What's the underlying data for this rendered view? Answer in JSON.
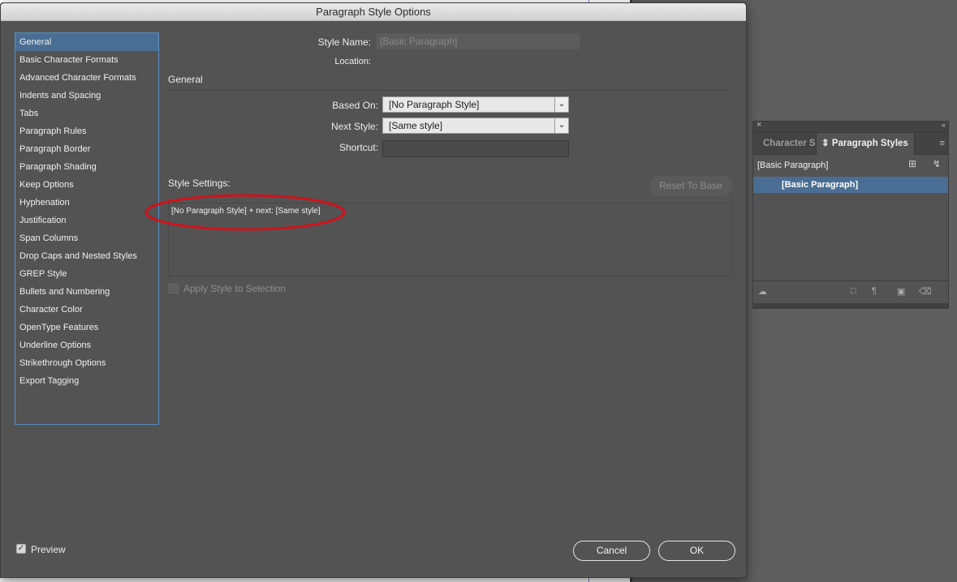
{
  "dialog": {
    "title": "Paragraph Style Options",
    "categories": [
      {
        "label": "General",
        "selected": true
      },
      {
        "label": "Basic Character Formats"
      },
      {
        "label": "Advanced Character Formats"
      },
      {
        "label": "Indents and Spacing"
      },
      {
        "label": "Tabs"
      },
      {
        "label": "Paragraph Rules"
      },
      {
        "label": "Paragraph Border"
      },
      {
        "label": "Paragraph Shading"
      },
      {
        "label": "Keep Options"
      },
      {
        "label": "Hyphenation"
      },
      {
        "label": "Justification"
      },
      {
        "label": "Span Columns"
      },
      {
        "label": "Drop Caps and Nested Styles"
      },
      {
        "label": "GREP Style"
      },
      {
        "label": "Bullets and Numbering"
      },
      {
        "label": "Character Color"
      },
      {
        "label": "OpenType Features"
      },
      {
        "label": "Underline Options"
      },
      {
        "label": "Strikethrough Options"
      },
      {
        "label": "Export Tagging"
      }
    ],
    "style_name_label": "Style Name:",
    "style_name_value": "[Basic Paragraph]",
    "location_label": "Location:",
    "general_heading": "General",
    "based_on_label": "Based On:",
    "based_on_value": "[No Paragraph Style]",
    "next_style_label": "Next Style:",
    "next_style_value": "[Same style]",
    "shortcut_label": "Shortcut:",
    "shortcut_value": "",
    "style_settings_label": "Style Settings:",
    "reset_button": "Reset To Base",
    "style_settings_text": "[No Paragraph Style] + next: [Same style]",
    "apply_label": "Apply Style to Selection",
    "apply_checked": false,
    "preview_label": "Preview",
    "preview_checked": true,
    "cancel_button": "Cancel",
    "ok_button": "OK",
    "highlight_color": "#d0121b",
    "selection_color": "#4a6e93"
  },
  "panel": {
    "tab_character": "Character S",
    "tab_paragraph": "Paragraph Styles",
    "current_style": "[Basic Paragraph]",
    "selected_style": "[Basic Paragraph]",
    "icons": [
      "close-icon",
      "collapse-icon",
      "panel-menu-icon",
      "new-style-icon",
      "lightning-icon",
      "cloud-icon",
      "folder-icon",
      "clear-overrides-icon",
      "new-icon",
      "trash-icon"
    ]
  }
}
